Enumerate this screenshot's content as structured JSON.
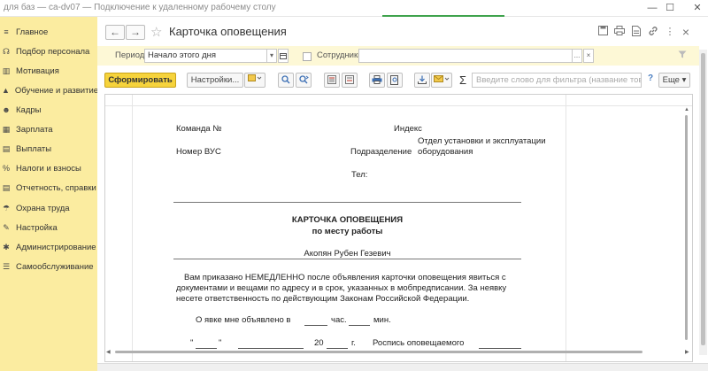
{
  "window": {
    "title": "для баз — ca-dv07 — Подключение к удаленному рабочему столу",
    "min_glyph": "—",
    "max_glyph": "☐",
    "close_glyph": "✕"
  },
  "sidebar": {
    "items": [
      {
        "label": "Главное",
        "icon": "menu-icon",
        "glyph": "≡"
      },
      {
        "label": "Подбор персонала",
        "icon": "recruit-icon",
        "glyph": "☊"
      },
      {
        "label": "Мотивация",
        "icon": "chart-icon",
        "glyph": "▥"
      },
      {
        "label": "Обучение и развитие",
        "icon": "graduation-icon",
        "glyph": "▲"
      },
      {
        "label": "Кадры",
        "icon": "people-icon",
        "glyph": "☻"
      },
      {
        "label": "Зарплата",
        "icon": "calculator-icon",
        "glyph": "▦"
      },
      {
        "label": "Выплаты",
        "icon": "payment-icon",
        "glyph": "▤"
      },
      {
        "label": "Налоги и взносы",
        "icon": "percent-icon",
        "glyph": "%"
      },
      {
        "label": "Отчетность, справки",
        "icon": "report-icon",
        "glyph": "▤"
      },
      {
        "label": "Охрана труда",
        "icon": "shield-icon",
        "glyph": "☂"
      },
      {
        "label": "Настройка",
        "icon": "wrench-icon",
        "glyph": "✎"
      },
      {
        "label": "Администрирование",
        "icon": "gear-icon",
        "glyph": "✱"
      },
      {
        "label": "Самообслуживание",
        "icon": "self-service-icon",
        "glyph": "☰"
      }
    ]
  },
  "header": {
    "back_glyph": "←",
    "forward_glyph": "→",
    "star_glyph": "☆",
    "title": "Карточка оповещения",
    "more_glyph": "⋮",
    "close_glyph": "×"
  },
  "filters": {
    "period_label": "Период:",
    "period_value": "Начало этого дня",
    "employees_label": "Сотрудники:",
    "employees_value": "",
    "dropdown_glyph": "▾",
    "ellipsis_glyph": "...",
    "clear_glyph": "×"
  },
  "toolbar": {
    "generate_label": "Сформировать",
    "settings_label": "Настройки...",
    "more_label": "Еще",
    "search_placeholder": "Введите слово для фильтра (название това...",
    "sigma": "Σ",
    "help": "?"
  },
  "document": {
    "team_label": "Команда №",
    "index_label": "Индекс",
    "vus_label": "Номер ВУС",
    "division_label": "Подразделение",
    "division_value_line1": "Отдел установки и эксплуатации",
    "division_value_line2": "оборудования",
    "phone_label": "Тел:",
    "card_title": "КАРТОЧКА ОПОВЕЩЕНИЯ",
    "card_subtitle": "по месту работы",
    "employee_name": "Акопян Рубен Гезевич",
    "paragraph_line1": "Вам приказано НЕМЕДЛЕННО после объявления карточки оповещения явиться с",
    "paragraph_line2": "документами и вещами по адресу и в срок, указанных в мобпредписании. За неявку",
    "paragraph_line3": "несете ответственность по действующим Законам Российской Федерации.",
    "announced_label": "О явке мне объявлено в",
    "hour_label": "час.",
    "minute_label": "мин.",
    "quote_open": "\"",
    "quote_close": "\"",
    "year_prefix": "20",
    "year_suffix": "г.",
    "signature_label": "Роспись оповещаемого"
  }
}
